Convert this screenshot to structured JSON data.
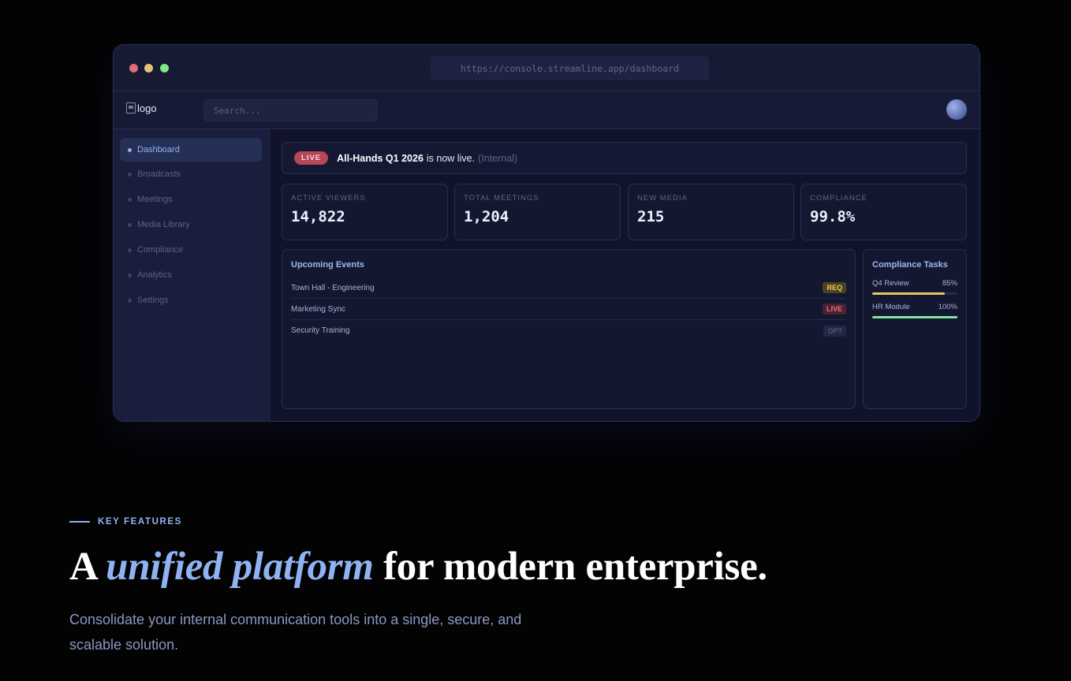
{
  "browser": {
    "url": "https://console.streamline.app/dashboard"
  },
  "appbar": {
    "logo_alt": "logo",
    "search_placeholder": "Search..."
  },
  "sidebar": {
    "items": [
      {
        "label": "Dashboard",
        "active": true
      },
      {
        "label": "Broadcasts",
        "active": false
      },
      {
        "label": "Meetings",
        "active": false
      },
      {
        "label": "Media Library",
        "active": false
      },
      {
        "label": "Compliance",
        "active": false
      },
      {
        "label": "Analytics",
        "active": false
      },
      {
        "label": "Settings",
        "active": false
      }
    ]
  },
  "banner": {
    "badge": "LIVE",
    "event": "All-Hands Q1 2026",
    "message": "is now live.",
    "note": "(Internal)"
  },
  "stats": [
    {
      "label": "ACTIVE VIEWERS",
      "value": "14,822"
    },
    {
      "label": "TOTAL MEETINGS",
      "value": "1,204"
    },
    {
      "label": "NEW MEDIA",
      "value": "215"
    },
    {
      "label": "COMPLIANCE",
      "value": "99.8%"
    }
  ],
  "events": {
    "title": "Upcoming Events",
    "rows": [
      {
        "name": "Town Hall - Engineering",
        "tag": "REQ"
      },
      {
        "name": "Marketing Sync",
        "tag": "LIVE"
      },
      {
        "name": "Security Training",
        "tag": "OPT"
      }
    ]
  },
  "tasks": {
    "title": "Compliance Tasks",
    "items": [
      {
        "name": "Q4 Review",
        "percent_label": "85%",
        "progress": 0.85,
        "color": "#e5c768"
      },
      {
        "name": "HR Module",
        "percent_label": "100%",
        "progress": 1.0,
        "color": "#7ee7a0"
      }
    ]
  },
  "landing": {
    "eyebrow": "KEY FEATURES",
    "headline_before": "A",
    "headline_emphasis": "unified platform",
    "headline_after": "for modern enterprise.",
    "lede": "Consolidate your internal communication tools into a single, secure, and scalable solution."
  },
  "colors": {
    "accent": "#8fb3f2",
    "live": "#b64757",
    "background": "#030304"
  }
}
